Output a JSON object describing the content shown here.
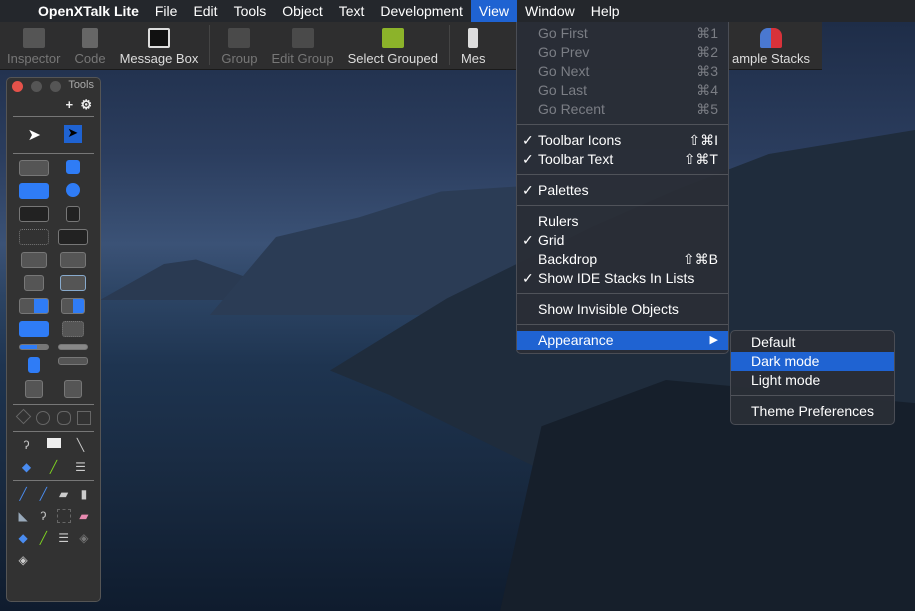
{
  "menubar": {
    "apple": "",
    "app": "OpenXTalk Lite",
    "items": [
      "File",
      "Edit",
      "Tools",
      "Object",
      "Text",
      "Development",
      "View",
      "Window",
      "Help"
    ],
    "active": "View"
  },
  "toolbar": {
    "items": [
      {
        "label": "Inspector",
        "enabled": false,
        "icon": "inspector-icon"
      },
      {
        "label": "Code",
        "enabled": false,
        "icon": "script-scroll-icon"
      },
      {
        "label": "Message Box",
        "enabled": true,
        "icon": "terminal-icon"
      },
      {
        "label": "Group",
        "enabled": false,
        "icon": "group-icon"
      },
      {
        "label": "Edit Group",
        "enabled": false,
        "icon": "edit-group-icon"
      },
      {
        "label": "Select Grouped",
        "enabled": true,
        "icon": "select-grouped-icon"
      },
      {
        "label": "Mes",
        "enabled": true,
        "icon": "messages-icon"
      },
      {
        "label": "ample Stacks",
        "enabled": true,
        "icon": "people-icon"
      }
    ]
  },
  "view_menu": {
    "groups": [
      [
        {
          "label": "Go First",
          "shortcut": "⌘1",
          "enabled": false
        },
        {
          "label": "Go Prev",
          "shortcut": "⌘2",
          "enabled": false
        },
        {
          "label": "Go Next",
          "shortcut": "⌘3",
          "enabled": false
        },
        {
          "label": "Go Last",
          "shortcut": "⌘4",
          "enabled": false
        },
        {
          "label": "Go Recent",
          "shortcut": "⌘5",
          "enabled": false
        }
      ],
      [
        {
          "label": "Toolbar Icons",
          "shortcut": "⇧⌘I",
          "checked": true
        },
        {
          "label": "Toolbar Text",
          "shortcut": "⇧⌘T",
          "checked": true
        }
      ],
      [
        {
          "label": "Palettes",
          "checked": true
        }
      ],
      [
        {
          "label": "Rulers"
        },
        {
          "label": "Grid",
          "checked": true
        },
        {
          "label": "Backdrop",
          "shortcut": "⇧⌘B"
        },
        {
          "label": "Show IDE Stacks In Lists",
          "checked": true
        }
      ],
      [
        {
          "label": "Show Invisible Objects"
        }
      ],
      [
        {
          "label": "Appearance",
          "submenu": true,
          "highlighted": true
        }
      ]
    ]
  },
  "appearance_submenu": {
    "items": [
      "Default",
      "Dark mode",
      "Light mode"
    ],
    "highlighted": "Dark mode",
    "extra": "Theme Preferences"
  },
  "palette": {
    "title": "Tools"
  },
  "colors": {
    "accent": "#1f63d2",
    "menubar": "#24272c",
    "toolbar": "#2e2e2f"
  }
}
